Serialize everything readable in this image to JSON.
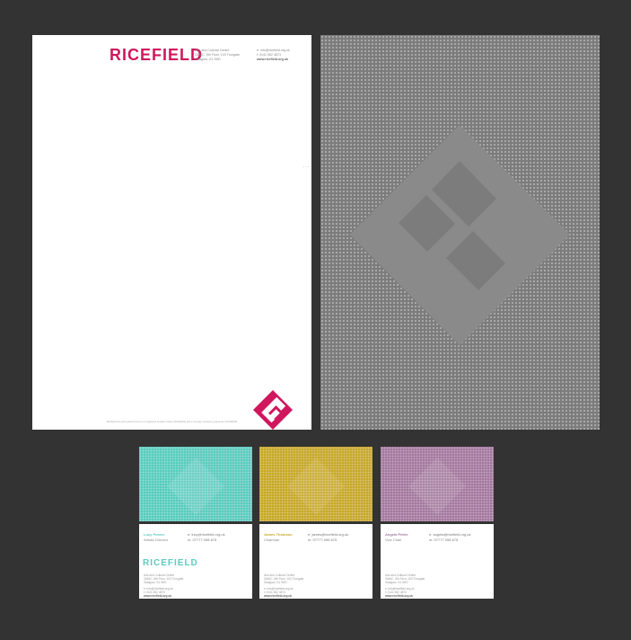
{
  "colors": {
    "background": "#333333",
    "brand_magenta": "#d0175e",
    "pattern_gray": "#7c7c7c",
    "card_teal": "#5ecbbf",
    "card_yellow": "#c8a82c",
    "card_purple": "#a47a9f"
  },
  "letterhead": {
    "logo": "RICEFIELD",
    "address": [
      "Arts and Cultural Centre",
      "GMAC, 5th Floor, 103 Trongate",
      "Glasgow, G1 5HD"
    ],
    "contact": [
      "e: info@ricefield.org.uk",
      "t: 0141 552 4873"
    ],
    "website": "www.ricefield.org.uk",
    "footer": "Ricefield Arts and Cultural Centre is a registered Scottish charity (SC032841) and a company limited by guarantee (SC268188)",
    "icon": "ricefield-mark-icon"
  },
  "pattern_sheet": {
    "icon": "ricefield-mark-icon"
  },
  "cards": [
    {
      "name": "Lucy Pearce",
      "role": "Artistic Director",
      "email": "e: lucy@ricefield.org.uk",
      "mobile": "m: 07777 098 675",
      "brand": "RICEFIELD",
      "address": [
        "Arts and Cultural Centre",
        "GMAC, 5th Floor, 103 Trongate",
        "Glasgow, G1 5HD"
      ],
      "contact": [
        "e: info@ricefield.org.uk",
        "t: 0141 552 4873"
      ],
      "website": "www.ricefield.org.uk"
    },
    {
      "name": "James Thomson",
      "role": "Chairman",
      "email": "e: james@ricefield.org.uk",
      "mobile": "m: 07777 098 675",
      "brand": "",
      "address": [
        "Arts and Cultural Centre",
        "GMAC, 5th Floor, 103 Trongate",
        "Glasgow, G1 5HD"
      ],
      "contact": [
        "e: info@ricefield.org.uk",
        "t: 0141 552 4873"
      ],
      "website": "www.ricefield.org.uk"
    },
    {
      "name": "Angela Petrie",
      "role": "Vice Chair",
      "email": "e: angela@ricefield.org.uk",
      "mobile": "m: 07777 098 675",
      "brand": "",
      "address": [
        "Arts and Cultural Centre",
        "GMAC, 5th Floor, 103 Trongate",
        "Glasgow, G1 5HD"
      ],
      "contact": [
        "e: info@ricefield.org.uk",
        "t: 0141 552 4873"
      ],
      "website": "www.ricefield.org.uk"
    }
  ]
}
